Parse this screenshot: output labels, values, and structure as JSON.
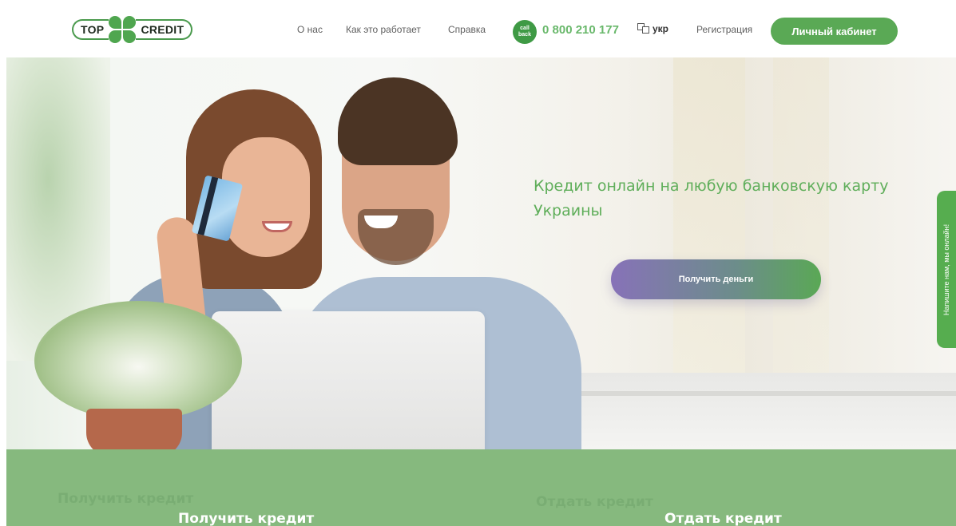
{
  "header": {
    "logo_left": "TOP",
    "logo_right": "CREDIT",
    "nav": [
      "О нас",
      "Как это работает",
      "Справка"
    ],
    "callback_line1": "call",
    "callback_line2": "back",
    "phone": "0 800 210 177",
    "language": "укр",
    "register": "Регистрация",
    "cabinet": "Личный кабинет"
  },
  "hero": {
    "title": "Кредит онлайн на любую банковскую карту Украины",
    "cta": "Получить деньги"
  },
  "chat_tab": "Напишите нам, мы онлайн!",
  "band": {
    "left_ghost": "Получить кредит",
    "left_title": "Получить кредит",
    "right_ghost": "Отдать кредит",
    "right_title": "Отдать кредит"
  },
  "colors": {
    "brand_green": "#5aa955",
    "title_green": "#5fae5a",
    "band_green": "#86b97e",
    "cta_purple": "#8772b8"
  }
}
